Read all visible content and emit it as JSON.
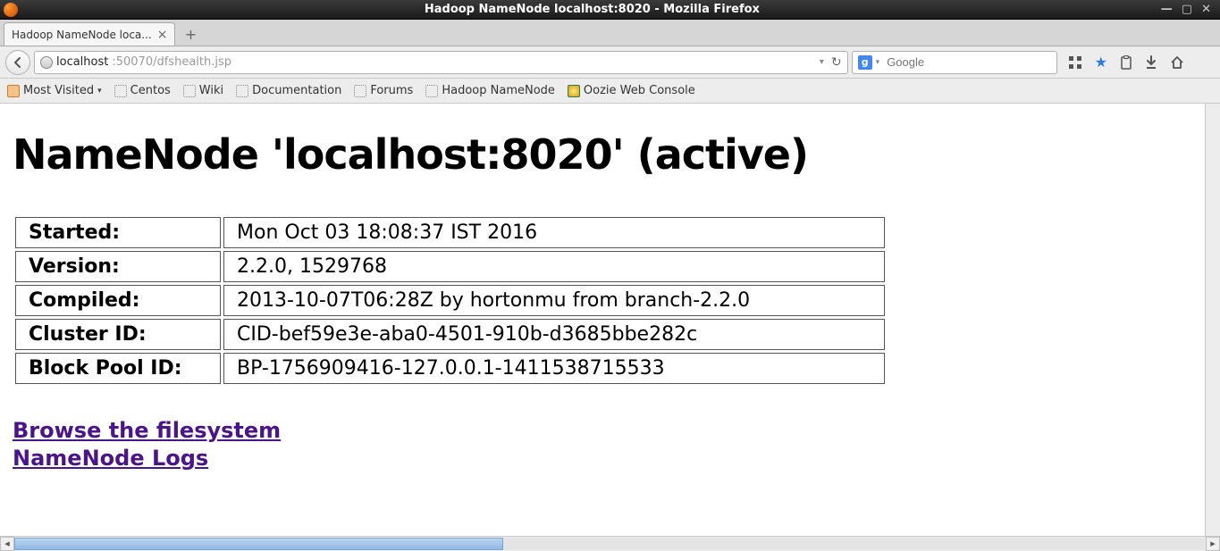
{
  "window": {
    "title": "Hadoop NameNode localhost:8020 - Mozilla Firefox"
  },
  "tab": {
    "label": "Hadoop NameNode loca..."
  },
  "url": {
    "host": "localhost",
    "rest": ":50070/dfshealth.jsp"
  },
  "search": {
    "placeholder": "Google",
    "engine_letter": "g"
  },
  "bookmarks": {
    "most_visited": "Most Visited",
    "centos": "Centos",
    "wiki": "Wiki",
    "documentation": "Documentation",
    "forums": "Forums",
    "hadoop_nn": "Hadoop NameNode",
    "oozie": "Oozie Web Console"
  },
  "page": {
    "heading": "NameNode 'localhost:8020' (active)",
    "rows": [
      {
        "label": "Started:",
        "value": "Mon Oct 03 18:08:37 IST 2016"
      },
      {
        "label": "Version:",
        "value": "2.2.0, 1529768"
      },
      {
        "label": "Compiled:",
        "value": "2013-10-07T06:28Z by hortonmu from branch-2.2.0"
      },
      {
        "label": "Cluster ID:",
        "value": "CID-bef59e3e-aba0-4501-910b-d3685bbe282c"
      },
      {
        "label": "Block Pool ID:",
        "value": "BP-1756909416-127.0.0.1-1411538715533"
      }
    ],
    "link_browse": "Browse the filesystem",
    "link_logs": "NameNode Logs"
  }
}
